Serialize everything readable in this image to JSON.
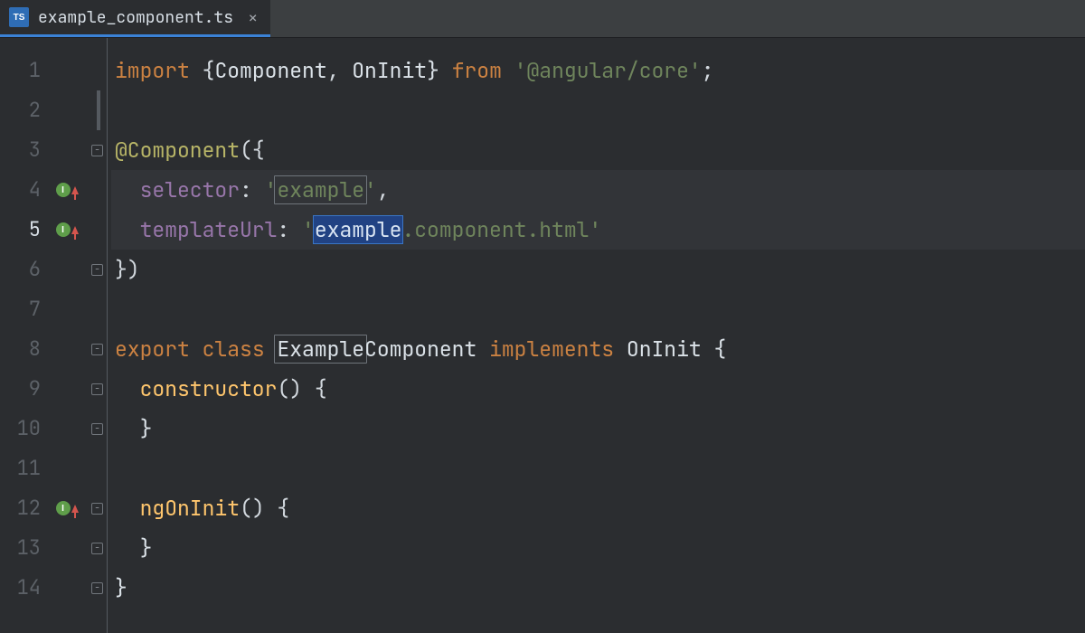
{
  "tab": {
    "filename": "example_component.ts",
    "file_icon": "typescript-file-icon",
    "close_glyph": "×"
  },
  "gutter": {
    "lines": [
      "1",
      "2",
      "3",
      "4",
      "5",
      "6",
      "7",
      "8",
      "9",
      "10",
      "11",
      "12",
      "13",
      "14"
    ],
    "current_line_index": 4,
    "markers": [
      {
        "line": 4,
        "type": "inlay-up"
      },
      {
        "line": 5,
        "type": "inlay-up"
      },
      {
        "line": 12,
        "type": "inlay-up"
      }
    ]
  },
  "code": {
    "l1_import": "import",
    "l1_lb": "{",
    "l1_comp": "Component",
    "l1_comma": ", ",
    "l1_oninit": "OnInit",
    "l1_rb": "}",
    "l1_from": "from",
    "l1_pkg": "'@angular/core'",
    "l1_semi": ";",
    "l3_dec": "@Component",
    "l3_paren": "({",
    "l4_key": "selector",
    "l4_colon": ": ",
    "l4_q1": "'",
    "l4_val": "example",
    "l4_q2": "'",
    "l4_comma": ",",
    "l5_key": "templateUrl",
    "l5_colon": ": ",
    "l5_q1": "'",
    "l5_sel": "example",
    "l5_rest": ".component.html",
    "l5_q2": "'",
    "l6": "})",
    "l8_export": "export",
    "l8_class": "class",
    "l8_name_boxed": "Example",
    "l8_name_rest": "Component",
    "l8_impl": "implements",
    "l8_on": "OnInit",
    "l8_brace": " {",
    "l9_ctor": "constructor",
    "l9_rest": "() {",
    "l10": "}",
    "l12_fn": "ngOnInit",
    "l12_rest": "() {",
    "l13": "}",
    "l14": "}",
    "indent1": "  ",
    "indent2": "    "
  }
}
